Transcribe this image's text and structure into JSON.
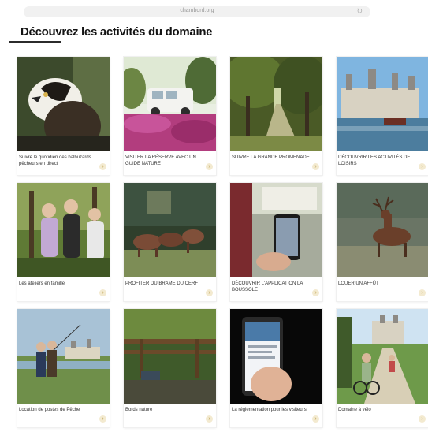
{
  "browser": {
    "url": "chambord.org",
    "reload_icon": "reload-icon"
  },
  "page": {
    "title": "Découvrez les activités du domaine"
  },
  "activities": [
    {
      "label": "Suivre le quotidien des balbuzards pêcheurs en direct",
      "image": "osprey"
    },
    {
      "label": "VISITER LA RÉSERVE AVEC UN GUIDE NATURE",
      "image": "jeep-heather"
    },
    {
      "label": "SUIVRE LA GRANDE PROMENADE",
      "image": "forest-avenue"
    },
    {
      "label": "DÉCOUVRIR LES ACTIVITÉS DE LOISIRS",
      "image": "chateau-river"
    },
    {
      "label": "Les ateliers en famille",
      "image": "family-binoculars"
    },
    {
      "label": "PROFITER DU BRAME DU CERF",
      "image": "deer-herd"
    },
    {
      "label": "DÉCOUVRIR L'APPLICATION LA BOUSSOLE",
      "image": "phone-app"
    },
    {
      "label": "LOUER UN AFFÛT",
      "image": "stag"
    },
    {
      "label": "Location de postes de Pêche",
      "image": "fishing-chateau"
    },
    {
      "label": "Bords nature",
      "image": "nature-sign"
    },
    {
      "label": "La réglementation pour les visiteurs",
      "image": "phone-hand"
    },
    {
      "label": "Domaine à vélo",
      "image": "bikes-chateau"
    }
  ],
  "arrow_icon": "chevron-right-icon",
  "colors": {
    "title": "#141414",
    "arrow_bg": "#f3ead0",
    "arrow": "#b89b45"
  }
}
